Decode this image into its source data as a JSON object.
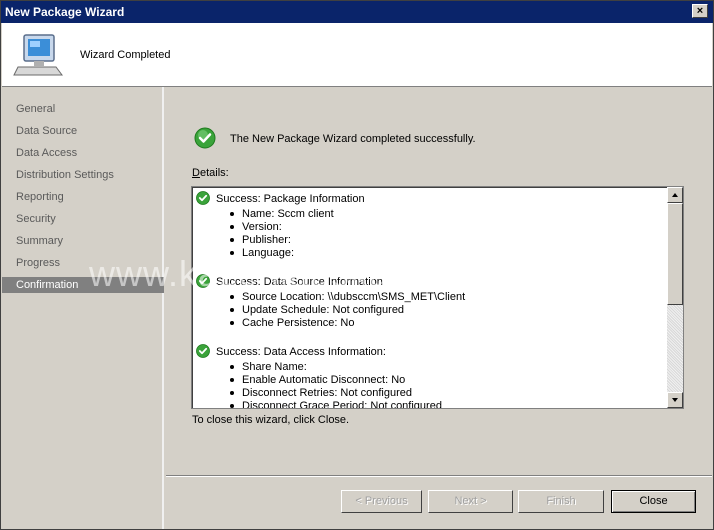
{
  "window": {
    "title": "New Package Wizard",
    "close_glyph": "×"
  },
  "header": {
    "title": "Wizard Completed",
    "icon": "computer-icon"
  },
  "nav": {
    "items": [
      {
        "label": "General"
      },
      {
        "label": "Data Source"
      },
      {
        "label": "Data Access"
      },
      {
        "label": "Distribution Settings"
      },
      {
        "label": "Reporting"
      },
      {
        "label": "Security"
      },
      {
        "label": "Summary"
      },
      {
        "label": "Progress"
      },
      {
        "label": "Confirmation",
        "active": true
      }
    ]
  },
  "content": {
    "success_message": "The New Package Wizard completed successfully.",
    "details_label": "Details:",
    "details": [
      {
        "title": "Success: Package Information",
        "items": [
          "Name: Sccm client",
          "Version:",
          "Publisher:",
          "Language:"
        ]
      },
      {
        "title": "Success: Data Source Information",
        "items": [
          "Source Location: \\\\dubsccm\\SMS_MET\\Client",
          "Update Schedule: Not configured",
          "Cache Persistence: No"
        ]
      },
      {
        "title": "Success: Data Access Information:",
        "items": [
          "Share Name:",
          "Enable Automatic Disconnect: No",
          "Disconnect Retries: Not configured",
          "Disconnect Grace Period: Not configured"
        ]
      }
    ],
    "close_hint": "To close this wizard, click Close."
  },
  "buttons": {
    "previous": "< Previous",
    "next": "Next >",
    "finish": "Finish",
    "close": "Close"
  },
  "watermark": "www.kazeniauskas.com/itblog",
  "colors": {
    "titlebar": "#0a246a",
    "success_green": "#3aa33a",
    "nav_active": "#808080"
  }
}
